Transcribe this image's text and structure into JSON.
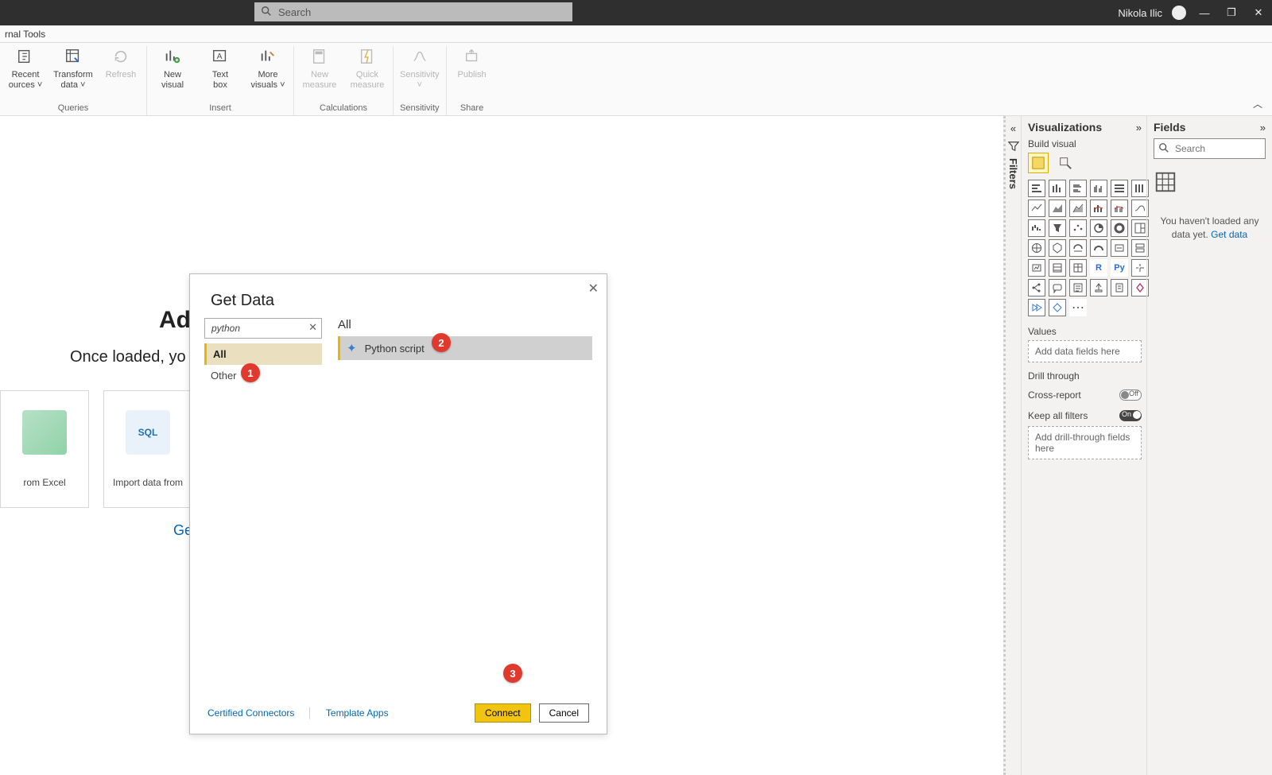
{
  "titlebar": {
    "searchPlaceholder": "Search",
    "user": "Nikola Ilic"
  },
  "ribbon": {
    "tab": "rnal Tools",
    "groups": {
      "queries": {
        "label": "Queries",
        "recent": "Recent\nources ˅",
        "transform": "Transform\ndata ˅",
        "refresh": "Refresh"
      },
      "insert": {
        "label": "Insert",
        "newVisual": "New\nvisual",
        "textBox": "Text\nbox",
        "moreVisuals": "More\nvisuals ˅"
      },
      "calculations": {
        "label": "Calculations",
        "newMeasure": "New\nmeasure",
        "quickMeasure": "Quick\nmeasure"
      },
      "sensitivity": {
        "label": "Sensitivity",
        "item": "Sensitivity\n˅"
      },
      "share": {
        "label": "Share",
        "publish": "Publish"
      }
    }
  },
  "canvas": {
    "title": "Ad",
    "subtitle": "Once loaded, yo",
    "cards": {
      "excel": "rom Excel",
      "sql": "Import data from",
      "sqlBadge": "SQL"
    },
    "link": "Ge"
  },
  "modal": {
    "title": "Get Data",
    "search": "python",
    "categories": {
      "all": "All",
      "other": "Other"
    },
    "rightHeader": "All",
    "result": "Python script",
    "footerLinks": {
      "certified": "Certified Connectors",
      "template": "Template Apps"
    },
    "buttons": {
      "connect": "Connect",
      "cancel": "Cancel"
    },
    "badges": {
      "b1": "1",
      "b2": "2",
      "b3": "3"
    }
  },
  "filtersPane": "Filters",
  "vis": {
    "title": "Visualizations",
    "build": "Build visual",
    "values": "Values",
    "valuesPH": "Add data fields here",
    "drill": "Drill through",
    "cross": "Cross-report",
    "crossState": "Off",
    "keep": "Keep all filters",
    "keepState": "On",
    "drillPH": "Add drill-through fields here",
    "rlabel": "R",
    "pylabel": "Py"
  },
  "fields": {
    "title": "Fields",
    "searchPH": "Search",
    "empty": "You haven't loaded any data yet.",
    "getData": "Get data"
  }
}
